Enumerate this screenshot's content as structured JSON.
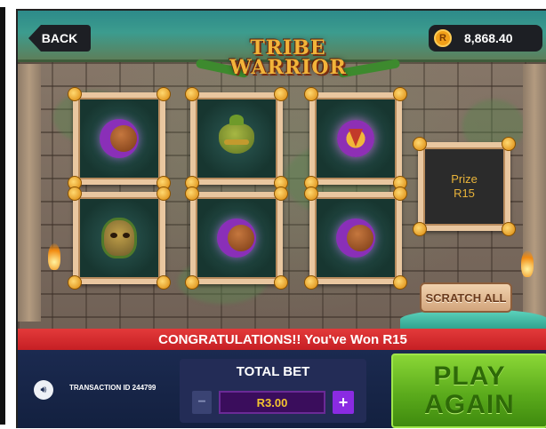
{
  "header": {
    "back_label": "BACK",
    "balance_currency": "R",
    "balance": "8,868.40",
    "logo_line1": "TRIBE",
    "logo_line2": "WARRIOR"
  },
  "tiles": [
    {
      "symbol": "moon-icon"
    },
    {
      "symbol": "pot-icon"
    },
    {
      "symbol": "amulet-icon"
    },
    {
      "symbol": "mask-icon"
    },
    {
      "symbol": "moon-icon"
    },
    {
      "symbol": "moon-icon"
    }
  ],
  "prize": {
    "label": "Prize",
    "amount": "R15"
  },
  "scratch_all_label": "SCRATCH ALL",
  "banner_text": "CONGRATULATIONS!! You've Won R15",
  "footer": {
    "transaction": "TRANSACTION ID 244799",
    "bet_title": "TOTAL BET",
    "minus_label": "−",
    "bet_value": "R3.00",
    "plus_label": "+",
    "play_line1": "PLAY",
    "play_line2": "AGAIN"
  },
  "colors": {
    "banner": "#d62a2e",
    "play_button": "#5bab1c",
    "bottom_bar": "#1b2a50",
    "bet_value_text": "#f4c430"
  }
}
